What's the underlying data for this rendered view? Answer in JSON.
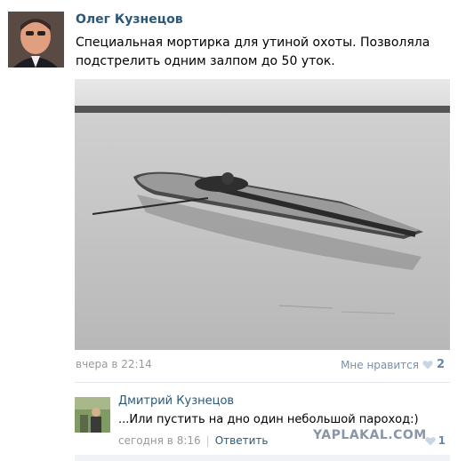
{
  "post": {
    "author": "Олег Кузнецов",
    "text": "Специальная мортирка для утиной охоты. Позволяла подстрелить одним залпом до 50 уток.",
    "date": "вчера в 22:14",
    "like_label": "Мне нравится",
    "like_count": "2",
    "avatar_icon": "user-avatar",
    "photo_icon": "boat-photo"
  },
  "comment": {
    "author": "Дмитрий Кузнецов",
    "text": "...Или пустить на дно один небольшой пароход:)",
    "date": "сегодня в 8:16",
    "separator": "|",
    "reply_label": "Ответить",
    "like_count": "1"
  },
  "watermark": "YAPLAKAL.COM",
  "colors": {
    "link": "#2b587a",
    "meta": "#999999",
    "like": "#6b87a8"
  }
}
